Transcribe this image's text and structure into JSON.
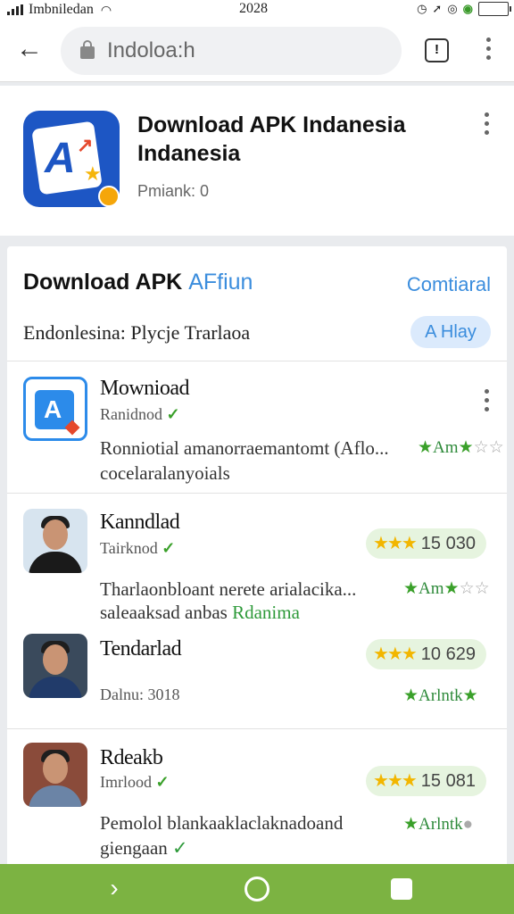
{
  "status_bar": {
    "carrier": "Imbniledan",
    "time": "2028"
  },
  "browser": {
    "url": "Indoloa:h",
    "tabs_count": "!"
  },
  "header_card": {
    "title": "Download APK Indanesia Indanesia",
    "subtitle": "Pmiank: 0"
  },
  "section": {
    "title": "Download APK",
    "title_accent": "AFfiun",
    "see_all": "Comtiaral",
    "subtitle": "Endonlesina: Plycje Trarlaoa",
    "chip": "A Hlay"
  },
  "rows": [
    {
      "name": "Mownioad",
      "dev": "Ranidnod",
      "desc_line1": "Ronniotial amanorraemantomt (Aflo...",
      "desc_line2": "cocelaralanyoials",
      "mini_rating": "Am",
      "icon": "app-icon"
    },
    {
      "name": "Kanndlad",
      "dev": "Tairknod",
      "rating": "15 030",
      "desc_line1": "Tharlaonbloant nerete arialacika...",
      "desc_line2": "saleaaksad anbas",
      "desc_link": "Rdanima",
      "mini_rating": "Am",
      "icon": "avatar"
    },
    {
      "name": "Tendarlad",
      "dev": "Dalnu: 3018",
      "rating": "10 629",
      "mini_rating": "Arlntk",
      "icon": "avatar"
    },
    {
      "name": "Rdeakb",
      "dev": "Imrlood",
      "rating": "15 081",
      "desc_line1": "Pemolol blankaaklaclaknadoand",
      "desc_line2": "giengaan",
      "mini_rating": "Arlntk",
      "icon": "avatar"
    }
  ],
  "colors": {
    "accent_blue": "#3b8ddd",
    "nav_green": "#7cb342",
    "star_gold": "#f2b600",
    "star_green": "#3aa02a"
  }
}
